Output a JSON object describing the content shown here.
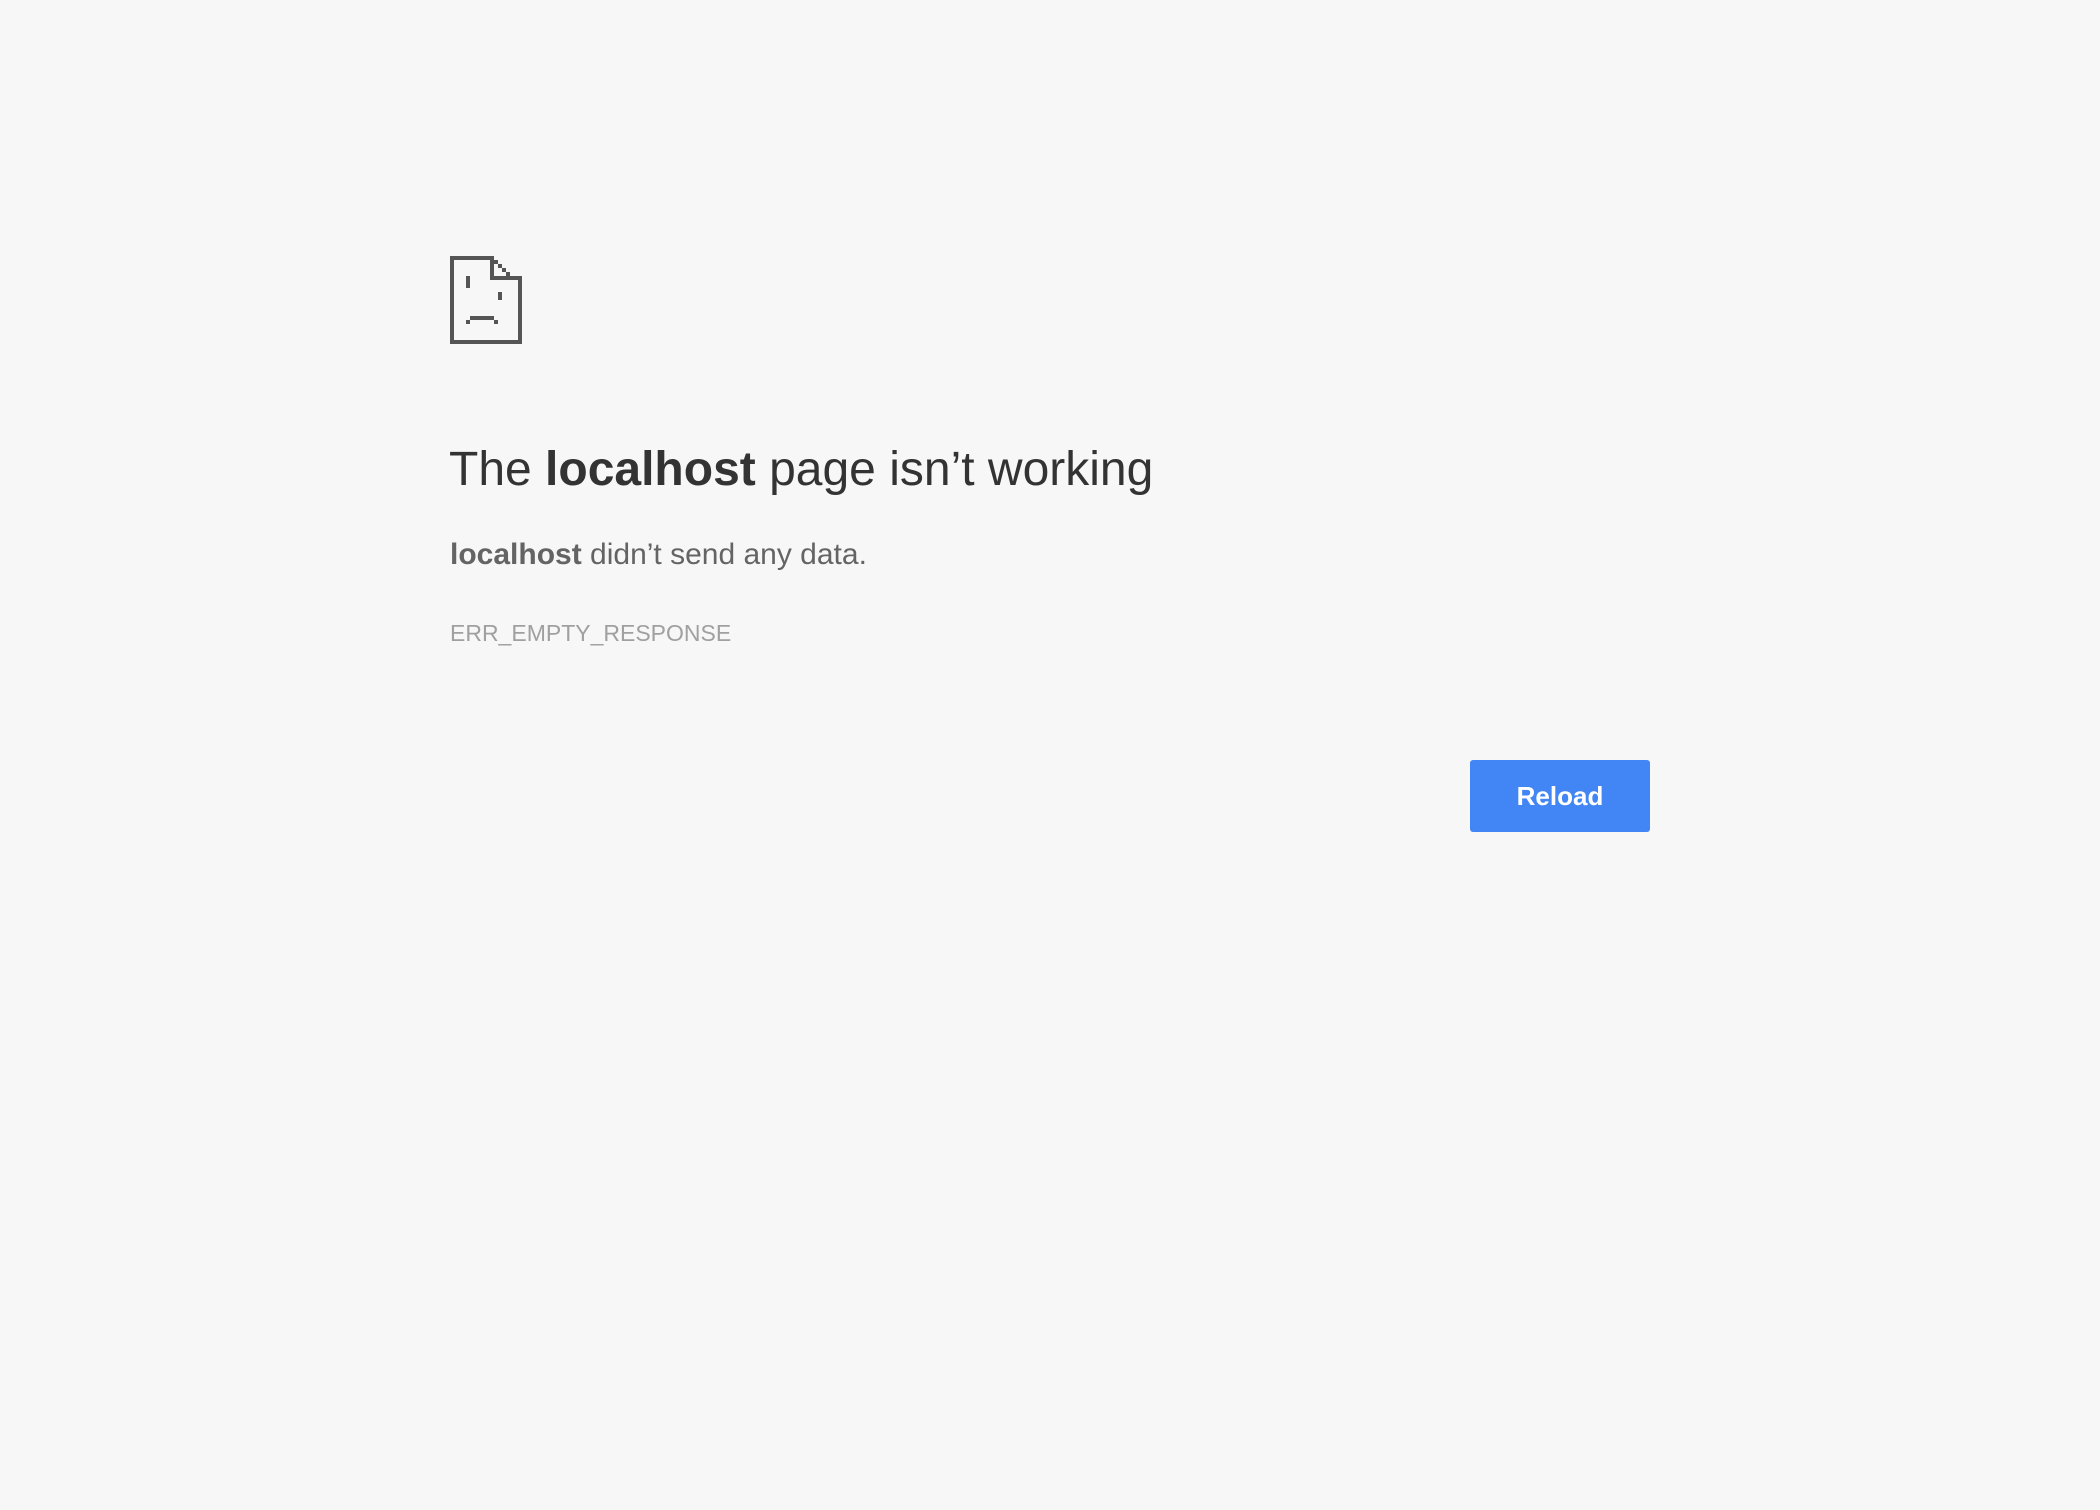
{
  "error": {
    "icon": "sad-document-icon",
    "title": {
      "prefix": "The ",
      "host": "localhost",
      "suffix": " page isn’t working"
    },
    "summary": {
      "host": "localhost",
      "text": " didn’t send any data."
    },
    "code": "ERR_EMPTY_RESPONSE"
  },
  "actions": {
    "reload_label": "Reload"
  },
  "colors": {
    "background": "#f7f7f7",
    "icon": "#555555",
    "title": "#333333",
    "summary": "#646464",
    "code": "#a0a0a0",
    "button": "#4285f4"
  }
}
